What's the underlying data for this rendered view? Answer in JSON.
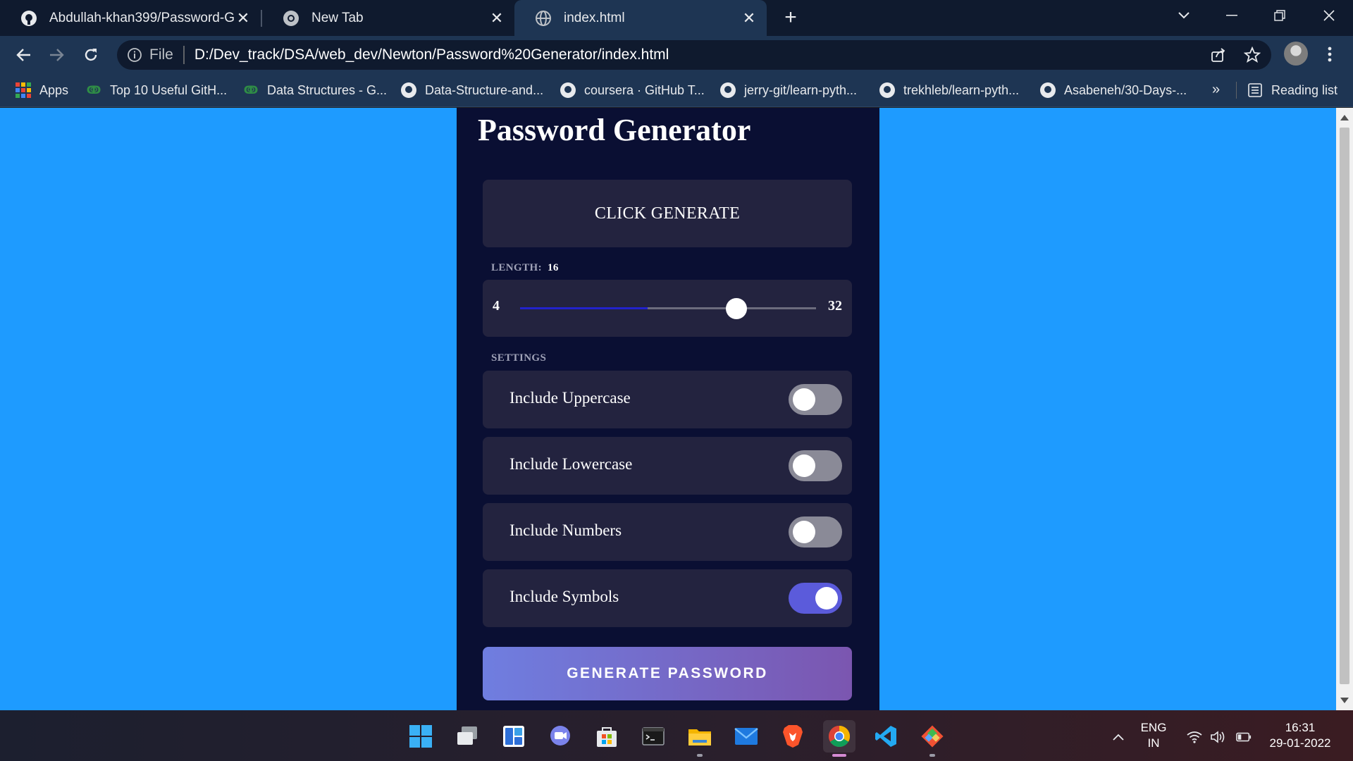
{
  "browser": {
    "tabs": [
      {
        "title": "Abdullah-khan399/Password-Generator",
        "icon": "github-icon"
      },
      {
        "title": "New Tab",
        "icon": "chrome-icon"
      },
      {
        "title": "index.html",
        "icon": "globe-icon",
        "active": true
      }
    ],
    "address": {
      "scheme_label": "File",
      "url": "D:/Dev_track/DSA/web_dev/Newton/Password%20Generator/index.html"
    },
    "bookmarks": [
      {
        "label": "Apps",
        "icon": "apps-grid-icon"
      },
      {
        "label": "Top 10 Useful GitH...",
        "icon": "geeksforgeeks-icon"
      },
      {
        "label": "Data Structures - G...",
        "icon": "geeksforgeeks-icon"
      },
      {
        "label": "Data-Structure-and...",
        "icon": "github-icon"
      },
      {
        "label": "coursera · GitHub T...",
        "icon": "github-icon"
      },
      {
        "label": "jerry-git/learn-pyth...",
        "icon": "github-icon"
      },
      {
        "label": "trekhleb/learn-pyth...",
        "icon": "github-icon"
      },
      {
        "label": "Asabeneh/30-Days-...",
        "icon": "github-icon"
      }
    ],
    "bookmarks_overflow": "»",
    "reading_list": "Reading list"
  },
  "app": {
    "title": "Password Generator",
    "result_placeholder": "CLICK GENERATE",
    "length_label": "LENGTH:",
    "length_value": "16",
    "length_number": 16,
    "slider_min": "4",
    "slider_max": "32",
    "slider_fill_fraction": 0.43,
    "slider_knob_fraction": 0.73,
    "settings_label": "SETTINGS",
    "settings": [
      {
        "label": "Include Uppercase",
        "on": false
      },
      {
        "label": "Include Lowercase",
        "on": false
      },
      {
        "label": "Include Numbers",
        "on": false
      },
      {
        "label": "Include Symbols",
        "on": true
      }
    ],
    "generate_label": "GENERATE PASSWORD"
  },
  "taskbar": {
    "apps": [
      "windows-start-icon",
      "task-view-icon",
      "widgets-icon",
      "teams-chat-icon",
      "microsoft-store-icon",
      "terminal-icon",
      "file-explorer-icon",
      "mail-icon",
      "brave-icon",
      "chrome-icon",
      "vscode-icon",
      "git-icon"
    ],
    "language": "ENG",
    "region": "IN",
    "time": "16:31",
    "date": "29-01-2022"
  },
  "colors": {
    "page_background": "#1e9bff",
    "panel": "#0a0f33",
    "card": "#23233f",
    "toggle_on": "#5b5bdb",
    "toggle_off": "#8a8a97",
    "button_gradient_start": "#6f7ee0",
    "button_gradient_end": "#7b56b0"
  }
}
